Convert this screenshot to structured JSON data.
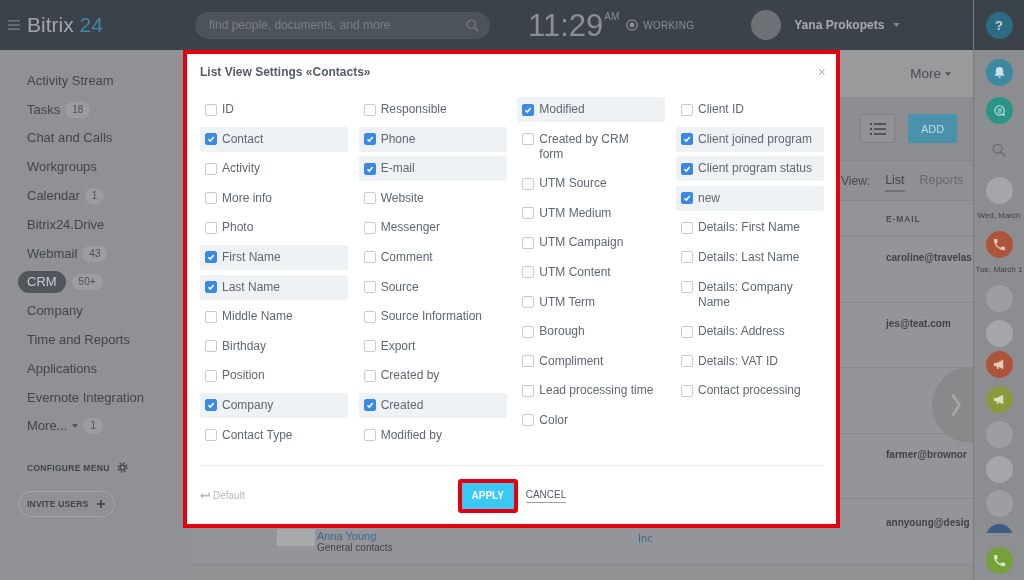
{
  "top_bar": {
    "logo": {
      "name": "Bitrix",
      "number": "24"
    },
    "search": {
      "placeholder": "find people, documents, and more"
    },
    "clock": {
      "time": "11:29",
      "period": "AM"
    },
    "status": "WORKING",
    "user": {
      "name": "Yana Prokopets"
    }
  },
  "sidebar": {
    "items": [
      {
        "label": "Activity Stream",
        "kind": "link",
        "selected": false
      },
      {
        "label": "Tasks",
        "count": "18",
        "kind": "link",
        "selected": false
      },
      {
        "label": "Chat and Calls",
        "kind": "link",
        "selected": false
      },
      {
        "label": "Workgroups",
        "kind": "link",
        "selected": false
      },
      {
        "label": "Calendar",
        "count": "1",
        "kind": "link",
        "selected": false
      },
      {
        "label": "Bitrix24.Drive",
        "kind": "link",
        "selected": false
      },
      {
        "label": "Webmail",
        "count": "43",
        "kind": "link",
        "selected": false
      },
      {
        "label": "CRM",
        "count": "50+",
        "kind": "link",
        "selected": true
      },
      {
        "label": "Company",
        "kind": "link",
        "selected": false
      },
      {
        "label": "Time and Reports",
        "kind": "link",
        "selected": false
      },
      {
        "label": "Applications",
        "kind": "link",
        "selected": false
      },
      {
        "label": "Evernote Integration",
        "kind": "link",
        "selected": false
      },
      {
        "label": "More...",
        "count": "1",
        "kind": "menu",
        "selected": false
      }
    ],
    "configure_menu": "CONFIGURE MENU",
    "invite_users": "INVITE USERS"
  },
  "content": {
    "more_menu": "More",
    "add_button": "ADD",
    "view": {
      "label": "View:",
      "tabs": [
        {
          "label": "List",
          "selected": true
        },
        {
          "label": "Reports",
          "selected": false
        }
      ]
    },
    "table": {
      "columns": [
        {
          "label": "E-MAIL"
        }
      ],
      "rows": [
        {
          "kind": "email",
          "email": "caroline@travelas"
        },
        {
          "kind": "email",
          "email": "jes@teat.com"
        },
        {
          "kind": "blank"
        },
        {
          "kind": "email",
          "email": "farmer@brownor"
        },
        {
          "kind": "contact",
          "name": "Anna Young",
          "group": "General contacts",
          "company": "Inc",
          "email": "annyoung@desig"
        }
      ]
    }
  },
  "dialog": {
    "title": "List View Settings «Contacts»",
    "close": "×",
    "columns": [
      {
        "fields": [
          {
            "label": "ID",
            "checked": false
          },
          {
            "label": "Contact",
            "checked": true
          },
          {
            "label": "Activity",
            "checked": false
          },
          {
            "label": "More info",
            "checked": false
          },
          {
            "label": "Photo",
            "checked": false
          },
          {
            "label": "First Name",
            "checked": true
          },
          {
            "label": "Last Name",
            "checked": true
          },
          {
            "label": "Middle Name",
            "checked": false
          },
          {
            "label": "Birthday",
            "checked": false
          },
          {
            "label": "Position",
            "checked": false
          },
          {
            "label": "Company",
            "checked": true
          },
          {
            "label": "Contact Type",
            "checked": false
          }
        ]
      },
      {
        "fields": [
          {
            "label": "Responsible",
            "checked": false
          },
          {
            "label": "Phone",
            "checked": true
          },
          {
            "label": "E-mail",
            "checked": true
          },
          {
            "label": "Website",
            "checked": false
          },
          {
            "label": "Messenger",
            "checked": false
          },
          {
            "label": "Comment",
            "checked": false
          },
          {
            "label": "Source",
            "checked": false
          },
          {
            "label": "Source Information",
            "checked": false
          },
          {
            "label": "Export",
            "checked": false
          },
          {
            "label": "Created by",
            "checked": false
          },
          {
            "label": "Created",
            "checked": true
          },
          {
            "label": "Modified by",
            "checked": false
          }
        ]
      },
      {
        "fields": [
          {
            "label": "Modified",
            "checked": true
          },
          {
            "label": "Created by CRM form",
            "checked": false
          },
          {
            "label": "UTM Source",
            "checked": false
          },
          {
            "label": "UTM Medium",
            "checked": false
          },
          {
            "label": "UTM Campaign",
            "checked": false
          },
          {
            "label": "UTM Content",
            "checked": false
          },
          {
            "label": "UTM Term",
            "checked": false
          },
          {
            "label": "Borough",
            "checked": false
          },
          {
            "label": "Compliment",
            "checked": false
          },
          {
            "label": "Lead processing time",
            "checked": false
          },
          {
            "label": "Color",
            "checked": false
          }
        ]
      },
      {
        "fields": [
          {
            "label": "Client ID",
            "checked": false
          },
          {
            "label": "Client joined program",
            "checked": true
          },
          {
            "label": "Client program status",
            "checked": true
          },
          {
            "label": "new",
            "checked": true
          },
          {
            "label": "Details: First Name",
            "checked": false
          },
          {
            "label": "Details: Last Name",
            "checked": false
          },
          {
            "label": "Details: Company Name",
            "checked": false
          },
          {
            "label": "Details: Address",
            "checked": false
          },
          {
            "label": "Details: VAT ID",
            "checked": false
          },
          {
            "label": "Contact processing",
            "checked": false
          }
        ]
      }
    ],
    "default": "Default",
    "apply": "APPLY",
    "cancel": "CANCEL"
  },
  "right_panel": {
    "help": "?",
    "dates": [
      "Wed, March",
      "Tue, March 1"
    ]
  }
}
